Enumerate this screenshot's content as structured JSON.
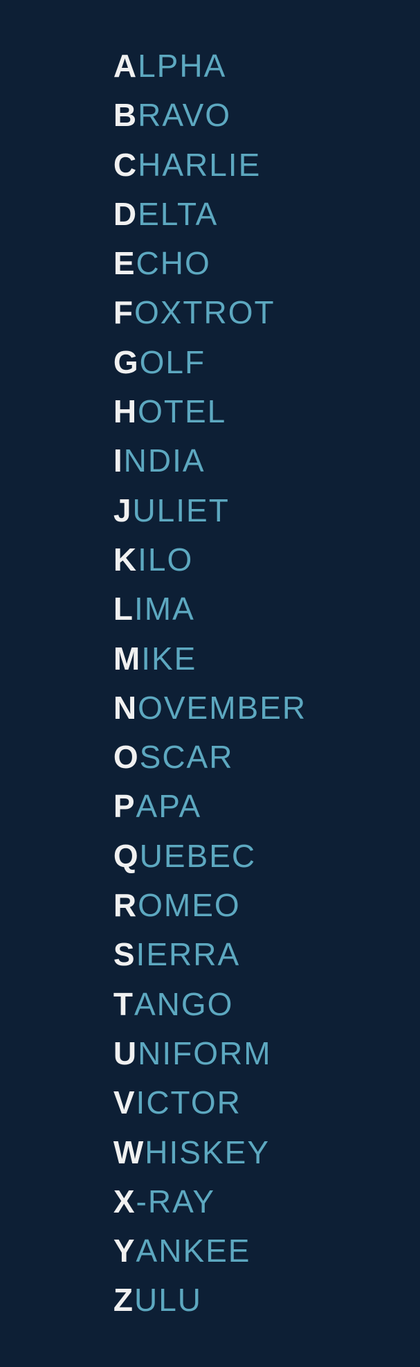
{
  "background": "#0d1f35",
  "accent_color": "#5da8c0",
  "initial_color": "#f0f0f0",
  "words": [
    {
      "initial": "A",
      "rest": "LPHA"
    },
    {
      "initial": "B",
      "rest": "RAVO"
    },
    {
      "initial": "C",
      "rest": "HARLIE"
    },
    {
      "initial": "D",
      "rest": "ELTA"
    },
    {
      "initial": "E",
      "rest": "CHO"
    },
    {
      "initial": "F",
      "rest": "OXTROT"
    },
    {
      "initial": "G",
      "rest": "OLF"
    },
    {
      "initial": "H",
      "rest": "OTEL"
    },
    {
      "initial": "I",
      "rest": "NDIA"
    },
    {
      "initial": "J",
      "rest": "ULIET"
    },
    {
      "initial": "K",
      "rest": "ILO"
    },
    {
      "initial": "L",
      "rest": "IMA"
    },
    {
      "initial": "M",
      "rest": "IKE"
    },
    {
      "initial": "N",
      "rest": "OVEMBER"
    },
    {
      "initial": "O",
      "rest": "SCAR"
    },
    {
      "initial": "P",
      "rest": "APA"
    },
    {
      "initial": "Q",
      "rest": "UEBEC"
    },
    {
      "initial": "R",
      "rest": "OMEO"
    },
    {
      "initial": "S",
      "rest": "IERRA"
    },
    {
      "initial": "T",
      "rest": "ANGO"
    },
    {
      "initial": "U",
      "rest": "NIFORM"
    },
    {
      "initial": "V",
      "rest": "ICTOR"
    },
    {
      "initial": "W",
      "rest": "HISKEY"
    },
    {
      "initial": "X",
      "rest": "-RAY"
    },
    {
      "initial": "Y",
      "rest": "ANKEE"
    },
    {
      "initial": "Z",
      "rest": "ULU"
    }
  ]
}
